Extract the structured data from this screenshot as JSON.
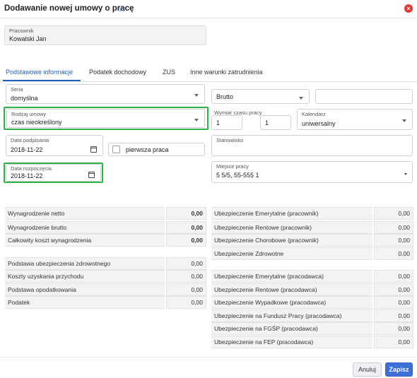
{
  "dialog": {
    "title": "Dodawanie nowej umowy o pracę"
  },
  "employee": {
    "label": "Pracownik",
    "value": "Kowalski Jan"
  },
  "tabs": [
    {
      "label": "Podstawowe informacje"
    },
    {
      "label": "Podatek dochodowy"
    },
    {
      "label": "ZUS"
    },
    {
      "label": "Inne warunki zatrudnienia"
    }
  ],
  "form": {
    "seria": {
      "label": "Seria",
      "value": "domyślna"
    },
    "brutto": {
      "value": "Brutto"
    },
    "amount": {
      "value": ""
    },
    "rodzaj": {
      "label": "Rodzaj umowy",
      "value": "czas nieokreślony"
    },
    "wymiar": {
      "label": "Wymiar czasu pracy",
      "num": "1",
      "sep": "/",
      "den": "1"
    },
    "kalendarz": {
      "label": "Kalendarz",
      "value": "uniwersalny"
    },
    "data_podpisania": {
      "label": "Data podpisania",
      "value": "2018-11-22"
    },
    "pierwsza_praca": {
      "label": "pierwsza praca"
    },
    "stanowisko": {
      "label": "Stanowisko",
      "value": ""
    },
    "data_rozpoczecia": {
      "label": "Data rozpoczęcia",
      "value": "2018-11-22"
    },
    "miejsce": {
      "label": "Miejsce pracy",
      "value": "5 5/5, 55-555 1"
    }
  },
  "left_top": [
    {
      "label": "Wynagrodzenie netto",
      "value": "0,00"
    },
    {
      "label": "Wynagrodzenie brutto",
      "value": "0,00"
    },
    {
      "label": "Całkowity koszt wynagrodzenia",
      "value": "0,00"
    }
  ],
  "left_bottom": [
    {
      "label": "Podstawa ubezpieczenia zdrowotnego",
      "value": "0,00"
    },
    {
      "label": "Koszty uzyskania przychodu",
      "value": "0,00"
    },
    {
      "label": "Podstawa opodatkowania",
      "value": "0,00"
    },
    {
      "label": "Podatek",
      "value": "0,00"
    }
  ],
  "right_top": [
    {
      "label": "Ubezpieczenie Emerytalne (pracownik)",
      "value": "0,00"
    },
    {
      "label": "Ubezpieczenie Rentowe (pracownik)",
      "value": "0,00"
    },
    {
      "label": "Ubezpieczenie Chorobowe (pracownik)",
      "value": "0,00"
    },
    {
      "label": "Ubezpieczenie Zdrowotne",
      "value": "0,00"
    }
  ],
  "right_bottom": [
    {
      "label": "Ubezpieczenie Emerytalne (pracodawca)",
      "value": "0,00"
    },
    {
      "label": "Ubezpieczenie Rentowe (pracodawca)",
      "value": "0,00"
    },
    {
      "label": "Ubezpieczenie Wypadkowe (pracodawca)",
      "value": "0,00"
    },
    {
      "label": "Ubezpieczenie na Fundusz Pracy (pracodawca)",
      "value": "0,00"
    },
    {
      "label": "Ubezpieczenie na FGŚP (pracodawca)",
      "value": "0,00"
    },
    {
      "label": "Ubezpieczenie na FEP (pracodawca)",
      "value": "0,00"
    }
  ],
  "buttons": {
    "cancel": "Anuluj",
    "save": "Zapisz"
  },
  "colors": {
    "accent": "#3d6fd8",
    "highlight": "#2eb34a",
    "close": "#e53935"
  }
}
